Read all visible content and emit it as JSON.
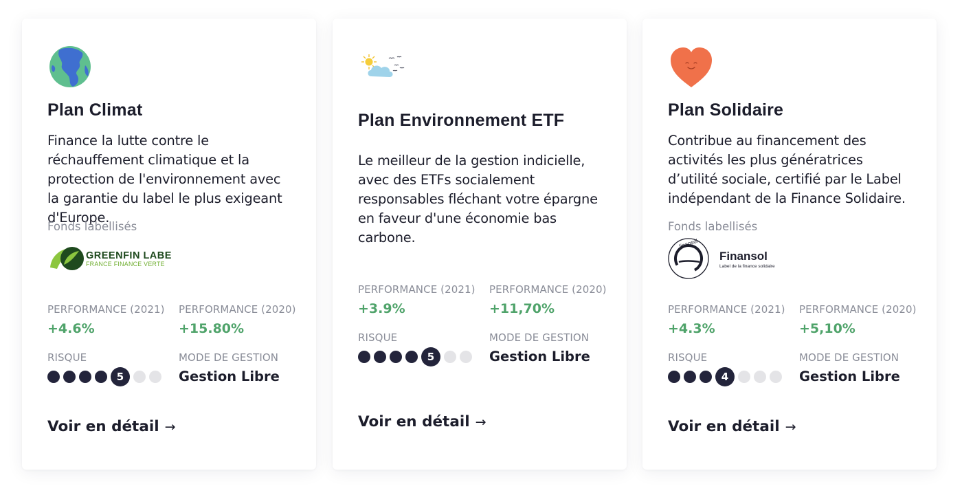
{
  "cards": [
    {
      "title": "Plan Climat",
      "description": "Finance la lutte contre le réchauffement climatique et la protection de l'environnement avec la garantie du label le plus exigeant d'Europe.",
      "icon": "earth-globe-icon",
      "fonds_label": "Fonds labellisés",
      "label_logo": {
        "name": "GREENFIN LABEL",
        "subtitle": "FRANCE FINANCE VERTE"
      },
      "perf_2021_label": "PERFORMANCE (2021)",
      "perf_2021_value": "+4.6%",
      "perf_2020_label": "PERFORMANCE (2020)",
      "perf_2020_value": "+15.80%",
      "risque_label": "RISQUE",
      "risk_level": 5,
      "risk_level_text": "5",
      "risk_max": 7,
      "mode_label": "MODE DE GESTION",
      "mode_value": "Gestion Libre",
      "link_label": "Voir en détail",
      "link_arrow": "→"
    },
    {
      "title": "Plan Environnement ETF",
      "description": "Le meilleur de la gestion indicielle, avec des ETFs socialement responsables fléchant votre épargne en faveur d'une économie bas carbone.",
      "icon": "cloud-sun-birds-icon",
      "perf_2021_label": "PERFORMANCE (2021)",
      "perf_2021_value": "+3.9%",
      "perf_2020_label": "PERFORMANCE (2020)",
      "perf_2020_value": "+11,70%",
      "risque_label": "RISQUE",
      "risk_level": 5,
      "risk_level_text": "5",
      "risk_max": 7,
      "mode_label": "MODE DE GESTION",
      "mode_value": "Gestion Libre",
      "link_label": "Voir en détail",
      "link_arrow": "→"
    },
    {
      "title": "Plan Solidaire",
      "description": "Contribue au financement des activités les plus génératrices d’utilité sociale, certifié par le Label indépendant de la Finance Solidaire.",
      "icon": "smiling-heart-icon",
      "fonds_label": "Fonds labellisés",
      "label_logo": {
        "name": "Finansol",
        "subtitle": "Label de la finance solidaire",
        "seal_text": "finansol"
      },
      "perf_2021_label": "PERFORMANCE (2021)",
      "perf_2021_value": "+4.3%",
      "perf_2020_label": "PERFORMANCE (2020)",
      "perf_2020_value": "+5,10%",
      "risque_label": "RISQUE",
      "risk_level": 4,
      "risk_level_text": "4",
      "risk_max": 7,
      "mode_label": "MODE DE GESTION",
      "mode_value": "Gestion Libre",
      "link_label": "Voir en détail",
      "link_arrow": "→"
    }
  ],
  "colors": {
    "text": "#1c1d2b",
    "muted": "#8a8d98",
    "positive": "#4fa36a",
    "risk_filled": "#23243b",
    "risk_empty": "#e4e4e7",
    "heart": "#f0714a",
    "greenfin_dark": "#1f4a1e",
    "greenfin_light": "#8cc63f"
  }
}
